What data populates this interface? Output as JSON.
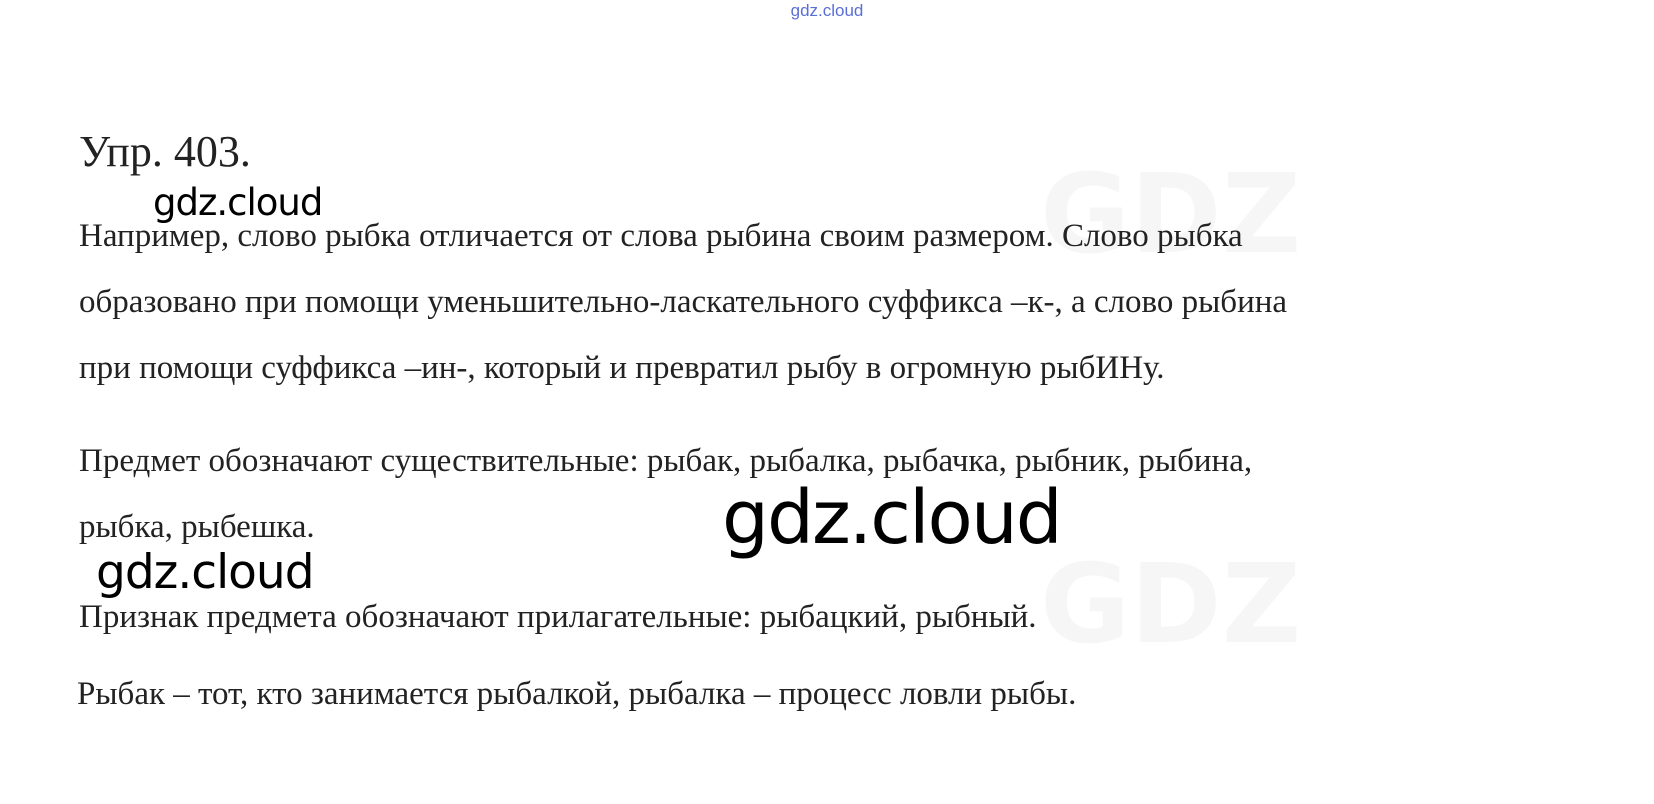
{
  "header": {
    "site_link": "gdz.cloud"
  },
  "document": {
    "title": "Упр. 403.",
    "paragraphs": [
      {
        "lines": [
          "Например, слово рыбка отличается от слова рыбина своим размером. Слово рыбка",
          "образовано при помощи уменьшительно-ласкательного суффикса –к-, а слово рыбина",
          "при помощи суффикса –ин-, который и превратил рыбу в огромную рыбИНу."
        ]
      },
      {
        "lines": [
          "Предмет обозначают существительные: рыбак, рыбалка, рыбачка, рыбник, рыбина,",
          "рыбка, рыбешка."
        ]
      },
      {
        "lines": [
          "Признак предмета обозначают прилагательные: рыбацкий, рыбный."
        ]
      },
      {
        "lines": [
          "Рыбак – тот, кто занимается рыбалкой, рыбалка – процесс ловли рыбы."
        ]
      }
    ]
  },
  "watermarks": {
    "small": "gdz.cloud",
    "large": "gdz.cloud",
    "medium": "gdz.cloud"
  },
  "colors": {
    "link": "#5a6fd6",
    "text": "#222222",
    "watermark": "#000000"
  }
}
